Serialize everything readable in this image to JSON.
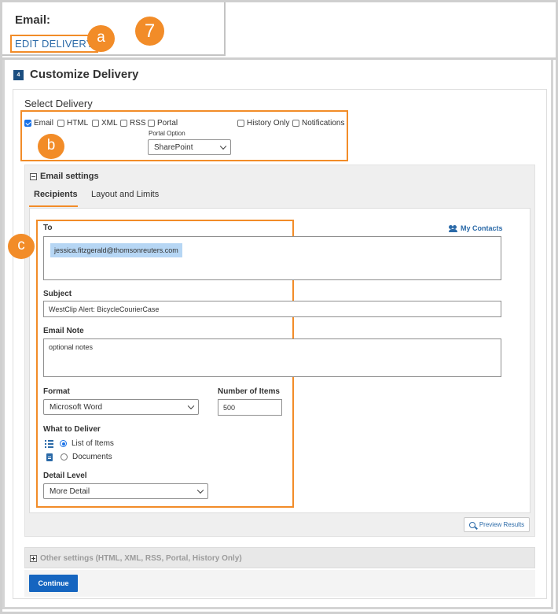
{
  "top": {
    "email_title": "Email:",
    "edit_delivery_label": "EDIT DELIVERY"
  },
  "callouts": {
    "a": "a",
    "seven": "7",
    "b": "b",
    "c": "c"
  },
  "step": {
    "number": "4",
    "title": "Customize Delivery"
  },
  "select_delivery": {
    "label": "Select Delivery",
    "options": [
      {
        "label": "Email",
        "checked": true
      },
      {
        "label": "HTML",
        "checked": false
      },
      {
        "label": "XML",
        "checked": false
      },
      {
        "label": "RSS",
        "checked": false
      },
      {
        "label": "Portal",
        "checked": false
      },
      {
        "label": "History Only",
        "checked": false
      },
      {
        "label": "Notifications",
        "checked": false
      }
    ],
    "portal_option_label": "Portal Option",
    "portal_option_value": "SharePoint"
  },
  "email_settings": {
    "title": "Email settings",
    "tabs": [
      "Recipients",
      "Layout and Limits"
    ]
  },
  "recipients": {
    "to_label": "To",
    "my_contacts_label": "My Contacts",
    "to_value": "jessica.fitzgerald@thomsonreuters.com",
    "subject_label": "Subject",
    "subject_value": "WestClip Alert: BicycleCourierCase",
    "email_note_label": "Email Note",
    "email_note_value": "optional notes",
    "format_label": "Format",
    "format_value": "Microsoft Word",
    "number_of_items_label": "Number of Items",
    "number_of_items_value": "500",
    "what_to_deliver_label": "What to Deliver",
    "deliver_options": [
      {
        "label": "List of Items",
        "checked": true
      },
      {
        "label": "Documents",
        "checked": false
      }
    ],
    "detail_level_label": "Detail Level",
    "detail_level_value": "More Detail"
  },
  "preview_results_label": "Preview Results",
  "other_settings_label": "Other settings (HTML, XML, RSS, Portal, History Only)",
  "continue_label": "Continue"
}
